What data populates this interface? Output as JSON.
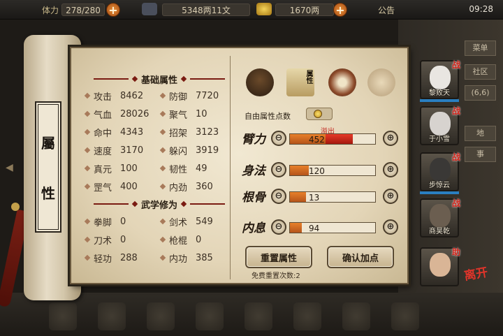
{
  "topbar": {
    "stamina_label": "体力",
    "stamina_value": "278/280",
    "silver_value": "5348两11文",
    "gold_value": "1670两",
    "notice_label": "公告",
    "clock": "09:28"
  },
  "scroll": {
    "title_chars": [
      "屬",
      "性"
    ]
  },
  "basic": {
    "header": "基础属性",
    "stats": [
      {
        "label": "攻击",
        "value": "8462"
      },
      {
        "label": "防御",
        "value": "7720"
      },
      {
        "label": "气血",
        "value": "28026"
      },
      {
        "label": "聚气",
        "value": "10"
      },
      {
        "label": "命中",
        "value": "4343"
      },
      {
        "label": "招架",
        "value": "3123"
      },
      {
        "label": "速度",
        "value": "3170"
      },
      {
        "label": "躲闪",
        "value": "3919"
      },
      {
        "label": "真元",
        "value": "100"
      },
      {
        "label": "韧性",
        "value": "49"
      },
      {
        "label": "罡气",
        "value": "400"
      },
      {
        "label": "内劲",
        "value": "360"
      }
    ]
  },
  "martial": {
    "header": "武学修为",
    "stats": [
      {
        "label": "拳脚",
        "value": "0"
      },
      {
        "label": "剑术",
        "value": "549"
      },
      {
        "label": "刀术",
        "value": "0"
      },
      {
        "label": "枪棍",
        "value": "0"
      },
      {
        "label": "轻功",
        "value": "288"
      },
      {
        "label": "内功",
        "value": "385"
      }
    ]
  },
  "tabs": {
    "active_label": "属性"
  },
  "points": {
    "free_label": "自由属性点数",
    "overflow_label": "溢出",
    "minus_glyph": "⊖",
    "plus_glyph": "⊕",
    "attributes": [
      {
        "char": "臂力",
        "value": "452",
        "fill": 0.42,
        "overflow": 0.32
      },
      {
        "char": "身法",
        "value": "120",
        "fill": 0.22,
        "overflow": 0
      },
      {
        "char": "根骨",
        "value": "13",
        "fill": 0.19,
        "overflow": 0
      },
      {
        "char": "内息",
        "value": "94",
        "fill": 0.14,
        "overflow": 0
      }
    ],
    "reset_button": "重置属性",
    "confirm_button": "确认加点",
    "reset_note": "免费重置次数:2"
  },
  "heroes": [
    {
      "name": "黎败天",
      "badge": "战",
      "face": "#e9e6e1"
    },
    {
      "name": "于小雪",
      "badge": "战",
      "face": "#d7d3cf"
    },
    {
      "name": "步惊云",
      "badge": "战",
      "face": "#3a3836"
    },
    {
      "name": "商昊乾",
      "badge": "战",
      "face": "#6b5e50"
    },
    {
      "name": "",
      "badge": "助",
      "face": "#d9b596"
    }
  ],
  "leave_label": "离开",
  "side_tabs": [
    "菜单",
    "社区",
    "(6,6)",
    "地",
    "事"
  ],
  "colors": {
    "accent_red": "#7a1b12",
    "bar_orange": "#e8802a",
    "overflow_red": "#e73a28"
  }
}
